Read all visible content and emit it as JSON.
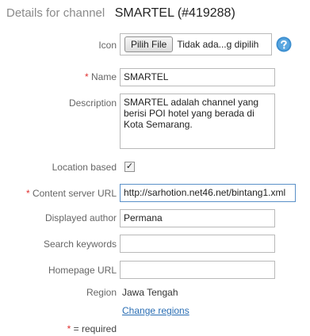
{
  "header": {
    "prefix": "Details for channel",
    "title": "SMARTEL (#419288)"
  },
  "form": {
    "icon": {
      "label": "Icon",
      "button_label": "Pilih File",
      "file_status": "Tidak ada...g dipilih"
    },
    "name": {
      "required_mark": "*",
      "label": "Name",
      "value": "SMARTEL"
    },
    "description": {
      "label": "Description",
      "value": "SMARTEL adalah channel yang berisi POI hotel yang berada di Kota Semarang."
    },
    "location_based": {
      "label": "Location based",
      "checked": true,
      "check_glyph": "✓"
    },
    "content_server_url": {
      "required_mark": "*",
      "label": "Content server URL",
      "value": "http://sarhotion.net46.net/bintang1.xml"
    },
    "displayed_author": {
      "label": "Displayed author",
      "value": "Permana"
    },
    "search_keywords": {
      "label": "Search keywords",
      "value": ""
    },
    "homepage_url": {
      "label": "Homepage URL",
      "value": ""
    },
    "region": {
      "label": "Region",
      "value": "Jawa Tengah",
      "change_link": "Change regions"
    }
  },
  "footer": {
    "required_star": "*",
    "required_note": "= required"
  },
  "icons": {
    "help": "help-icon"
  },
  "colors": {
    "required": "#e03030",
    "link": "#2a6eb4",
    "help_icon": "#3d8fd0"
  }
}
